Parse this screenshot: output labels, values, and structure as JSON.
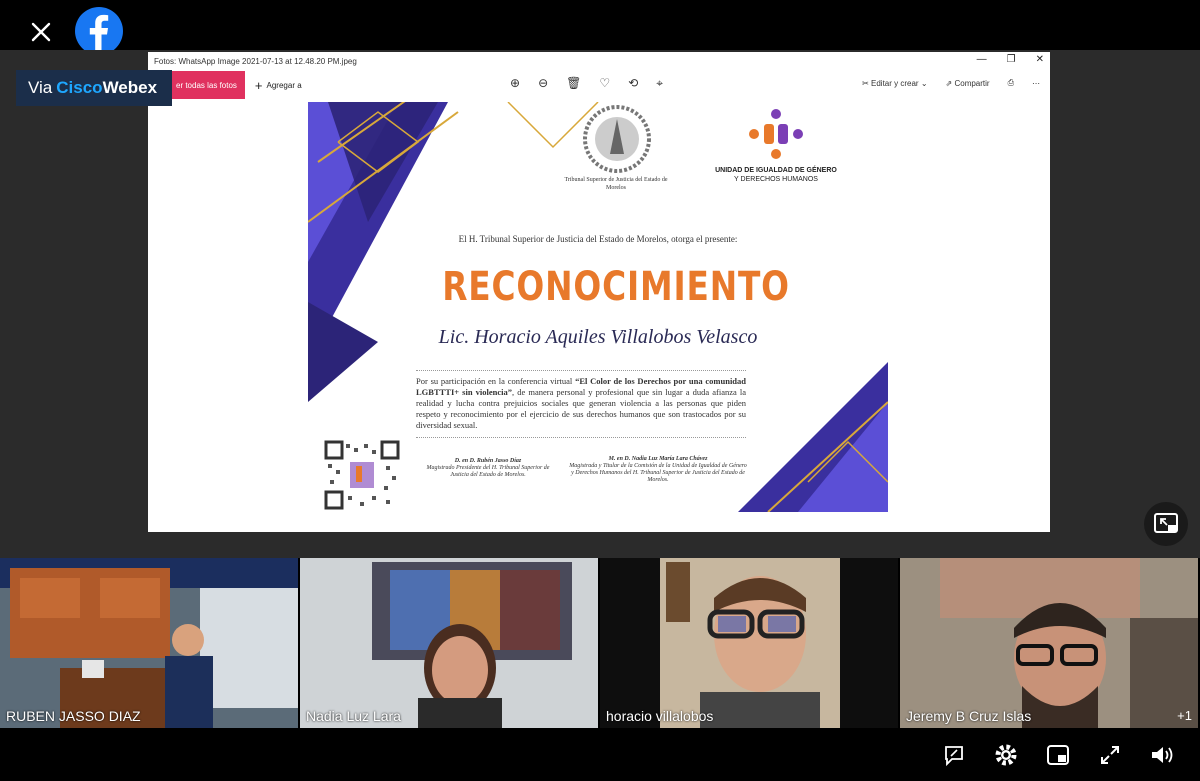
{
  "webex": {
    "via": "Via",
    "brand_a": "Cisco",
    "brand_b": "Webex"
  },
  "photos_window": {
    "title": "Fotos: WhatsApp Image 2021-07-13 at 12.48.20 PM.jpeg",
    "see_all": "er todas las fotos",
    "add": "Agregar a",
    "edit_create": "Editar y crear",
    "share": "Compartir"
  },
  "certificate": {
    "tsj_caption": "Tribunal Superior de Justicia del Estado de Morelos",
    "ugdh_line1": "UNIDAD DE IGUALDAD DE GÉNERO",
    "ugdh_line2": "Y DERECHOS HUMANOS",
    "intro": "El H. Tribunal Superior de Justicia del Estado de Morelos, otorga el presente:",
    "title": "RECONOCIMIENTO",
    "recipient": "Lic. Horacio Aquiles Villalobos Velasco",
    "body_pre": "Por su participación en la conferencia virtual ",
    "body_bold": "“El Color de los Derechos por una comunidad LGBTTTI+ sin violencia”",
    "body_post": ", de manera personal y profesional que sin lugar a duda afianza la realidad y lucha contra prejuicios sociales que generan violencia a las personas que piden respeto y reconocimiento por el ejercicio de sus derechos humanos que son trastocados por su diversidad sexual.",
    "sig1_name": "D. en D. Rubén Jasso Díaz",
    "sig1_role": "Magistrado Presidente del H. Tribunal Superior de Justicia del Estado de Morelos.",
    "sig2_name": "M. en D. Nadia Luz María Lara Chávez",
    "sig2_role": "Magistrada y Titular de la Comisión de la Unidad de Igualdad de Género y Derechos Humanos del H. Tribunal Superior de Justicia del Estado de Morelos."
  },
  "participants": [
    {
      "name": "RUBEN JASSO DIAZ"
    },
    {
      "name": "Nadia Luz Lara"
    },
    {
      "name": "horacio villalobos"
    },
    {
      "name": "Jeremy B Cruz Islas"
    }
  ],
  "extra_participants": "+1",
  "colors": {
    "accent_pink": "#e0315f",
    "title_orange": "#e8792b",
    "webex_blue": "#1ea7ff",
    "cert_purple": "#3a2f9e"
  }
}
